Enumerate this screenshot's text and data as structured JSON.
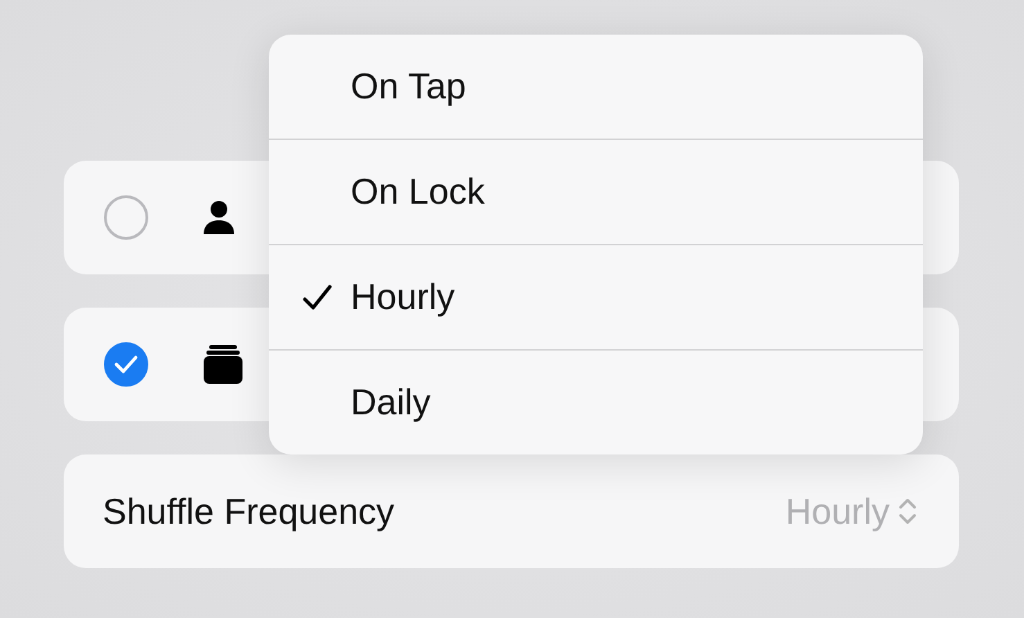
{
  "options": [
    {
      "kind": "person",
      "selected": false
    },
    {
      "kind": "stack",
      "selected": true
    }
  ],
  "setting": {
    "label": "Shuffle Frequency",
    "value": "Hourly"
  },
  "menu": {
    "items": [
      {
        "label": "On Tap",
        "selected": false
      },
      {
        "label": "On Lock",
        "selected": false
      },
      {
        "label": "Hourly",
        "selected": true
      },
      {
        "label": "Daily",
        "selected": false
      }
    ]
  }
}
